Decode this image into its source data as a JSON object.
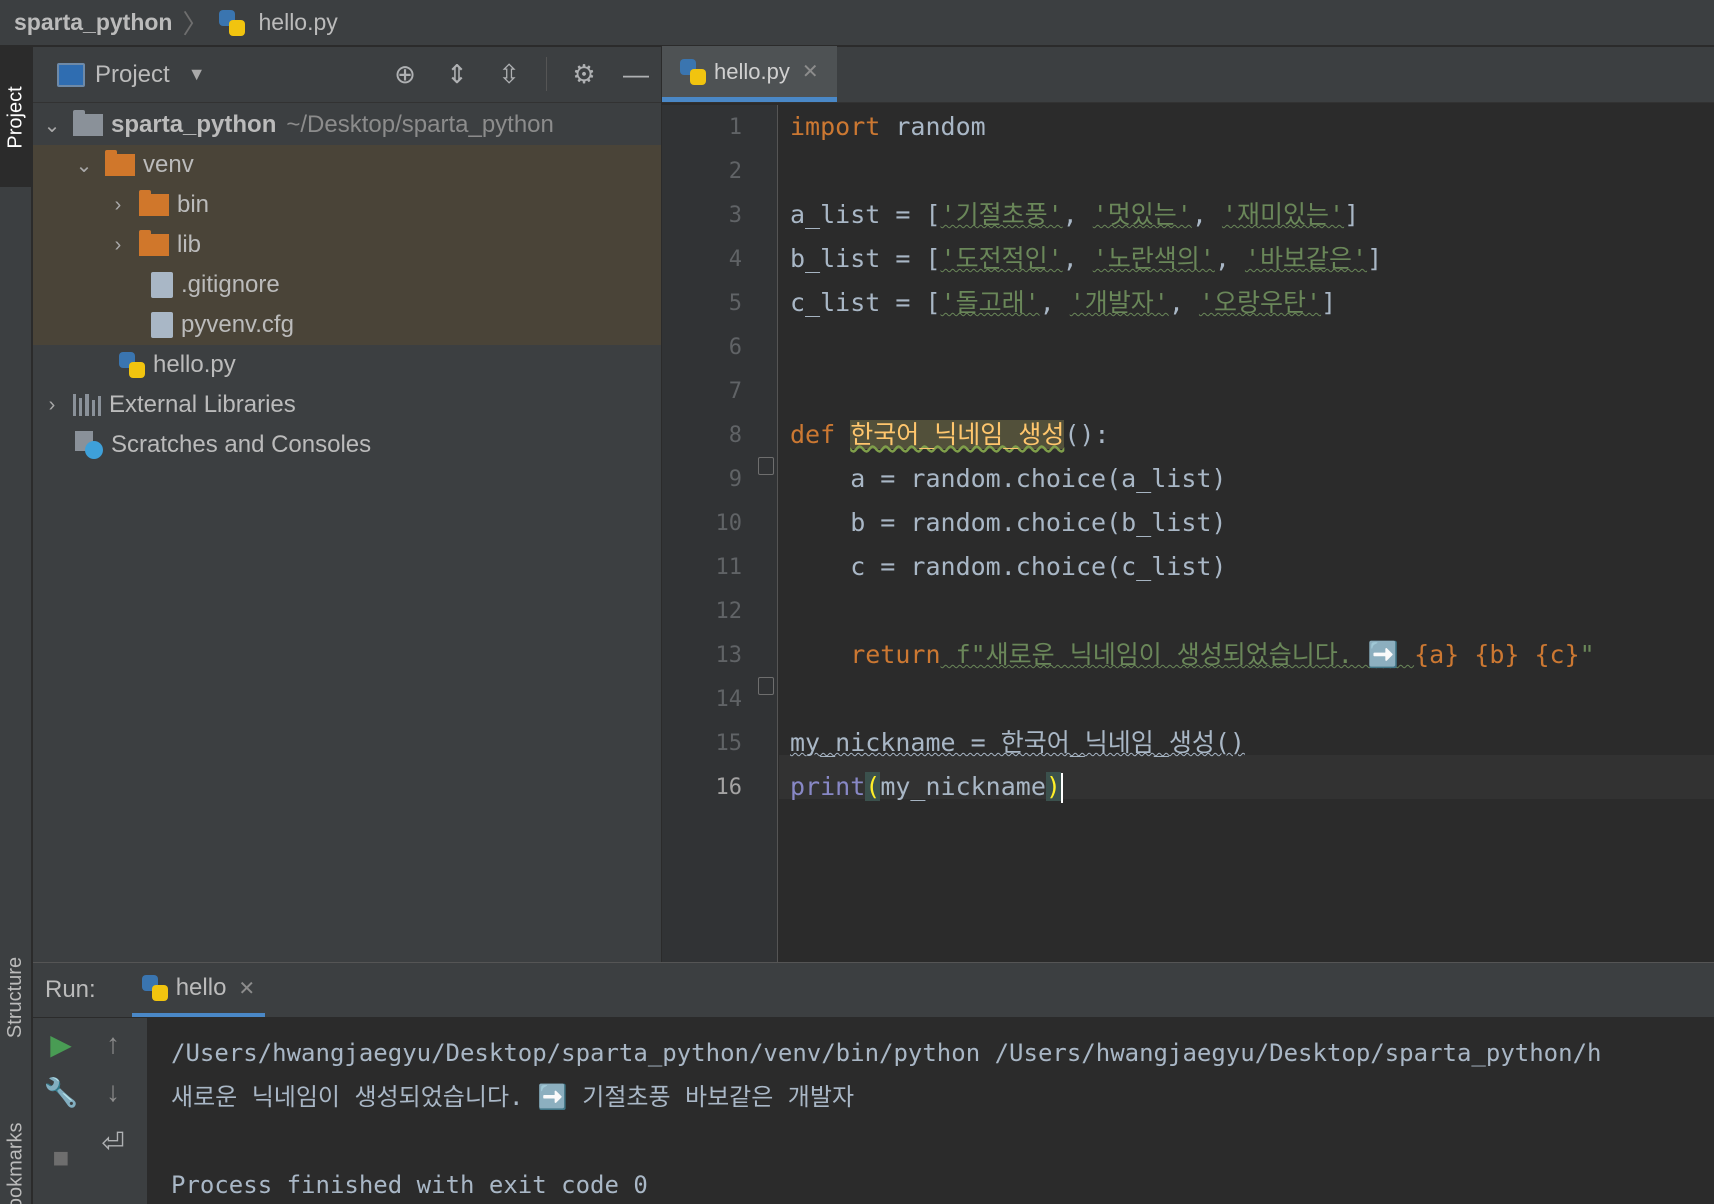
{
  "breadcrumb": {
    "project": "sparta_python",
    "file": "hello.py"
  },
  "left_tabs": {
    "project": "Project",
    "structure": "Structure",
    "bookmarks": "Bookmarks"
  },
  "project_panel": {
    "title": "Project",
    "tree": [
      {
        "label": "sparta_python",
        "path": "~/Desktop/sparta_python"
      },
      {
        "label": "venv"
      },
      {
        "label": "bin"
      },
      {
        "label": "lib"
      },
      {
        "label": ".gitignore"
      },
      {
        "label": "pyvenv.cfg"
      },
      {
        "label": "hello.py"
      },
      {
        "label": "External Libraries"
      },
      {
        "label": "Scratches and Consoles"
      }
    ]
  },
  "editor": {
    "tab": "hello.py",
    "line_numbers": [
      "1",
      "2",
      "3",
      "4",
      "5",
      "6",
      "7",
      "8",
      "9",
      "10",
      "11",
      "12",
      "13",
      "14",
      "15",
      "16"
    ],
    "code": {
      "l1_kw": "import",
      "l1_rest": " random",
      "l3_a": "a_list = [",
      "l3_s1": "'기절초풍'",
      "l3_c1": ", ",
      "l3_s2": "'멋있는'",
      "l3_c2": ", ",
      "l3_s3": "'재미있는'",
      "l3_e": "]",
      "l4_a": "b_list = [",
      "l4_s1": "'도전적인'",
      "l4_c1": ", ",
      "l4_s2": "'노란색의'",
      "l4_c2": ", ",
      "l4_s3": "'바보같은'",
      "l4_e": "]",
      "l5_a": "c_list = [",
      "l5_s1": "'돌고래'",
      "l5_c1": ", ",
      "l5_s2": "'개발자'",
      "l5_c2": ", ",
      "l5_s3": "'오랑우탄'",
      "l5_e": "]",
      "l8_kw": "def",
      "l8_fn": "한국어_닉네임_생성",
      "l8_rest": "():",
      "l9": "    a = random.choice(a_list)",
      "l10": "    b = random.choice(b_list)",
      "l11": "    c = random.choice(c_list)",
      "l13_kw": "    return",
      "l13_str": " f\"새로운 닉네임이 생성되었습니다. ➡️ ",
      "l13_a": "{a}",
      "l13_sp1": " ",
      "l13_b": "{b}",
      "l13_sp2": " ",
      "l13_c": "{c}",
      "l13_q": "\"",
      "l15": "my_nickname = 한국어_닉네임_생성()",
      "l16_fn": "print",
      "l16_open": "(",
      "l16_arg": "my_nickname",
      "l16_close": ")"
    }
  },
  "run_panel": {
    "label": "Run:",
    "tab": "hello",
    "output": [
      "/Users/hwangjaegyu/Desktop/sparta_python/venv/bin/python /Users/hwangjaegyu/Desktop/sparta_python/h",
      "새로운 닉네임이 생성되었습니다. ➡️ 기절초풍 바보같은 개발자",
      "",
      "Process finished with exit code 0"
    ]
  },
  "colors": {
    "accent": "#4a88c7",
    "keyword": "#cc7832",
    "string": "#6a8759",
    "function": "#ffc66d",
    "builtin": "#8888c6",
    "venv_highlight": "#4a4438"
  }
}
